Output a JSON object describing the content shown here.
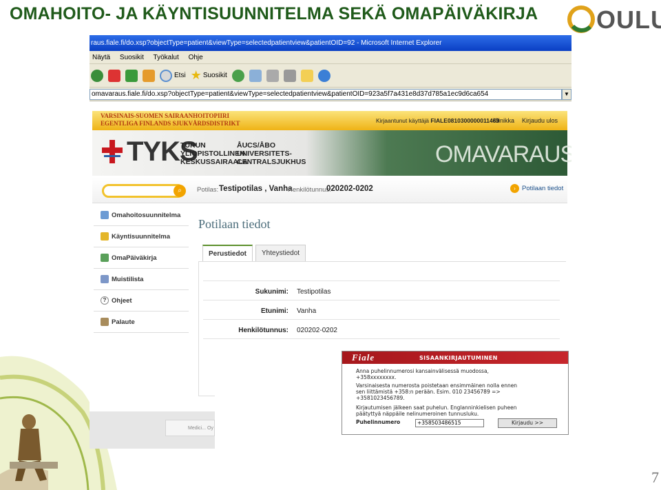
{
  "slide": {
    "title": "OMAHOITO- JA KÄYNTISUUNNITELMA SEKÄ OMAPÄIVÄKIRJA",
    "logo_text": "OULU",
    "page_number": "7"
  },
  "browser": {
    "title": "raus.fiale.fi/do.xsp?objectType=patient&viewType=selectedpatientview&patientOID=92 - Microsoft Internet Explorer",
    "menu": [
      "Näytä",
      "Suosikit",
      "Työkalut",
      "Ohje"
    ],
    "toolbar": {
      "search_label": "Etsi",
      "favorites_label": "Suosikit"
    },
    "address": "omavaraus.fiale.fi/do.xsp?objectType=patient&viewType=selectedpatientview&patientOID=923a5f7a431e8d37d785a1ec9d6ca654"
  },
  "page": {
    "hospital_fi": "Varsinais-Suomen sairaanhoitopiiri",
    "hospital_sv": "Egentliga Finlands sjukvårdsdistrikt",
    "login_prefix": "Kirjaantunut käyttäjä",
    "login_user": "FIALE0810300000011469",
    "link_clinic": "Klinikka",
    "link_logout": "Kirjaudu ulos",
    "tyks": "TYKS",
    "tyks_fi": [
      "TURUN",
      "YLIOPISTOLLINEN",
      "KESKUSSAIRAALA"
    ],
    "tyks_sv": [
      "ÅUCS/ÅBO",
      "UNIVERSITETS-",
      "CENTRALSJUKHUS"
    ],
    "brand": "OMAVARAUS",
    "patient_label": "Potilas:",
    "patient_name": "Testipotilas , Vanha",
    "ssn_label": "Henkilötunnus:",
    "ssn_value": "020202-0202",
    "patient_info_link": "Potilaan tiedot",
    "sidebar": [
      "Omahoitosuunnitelma",
      "Käyntisuunnitelma",
      "OmaPäiväkirja",
      "Muistilista",
      "Ohjeet",
      "Palaute"
    ],
    "content_title": "Potilaan tiedot",
    "tabs": [
      "Perustiedot",
      "Yhteystiedot"
    ],
    "fields": [
      {
        "label": "Sukunimi:",
        "value": "Testipotilas"
      },
      {
        "label": "Etunimi:",
        "value": "Vanha"
      },
      {
        "label": "Henkilötunnus:",
        "value": "020202-0202"
      }
    ],
    "footer_text": "Medici... Oy"
  },
  "fiale": {
    "logo": "Fiale",
    "header": "SISAANKIRJAUTUMINEN",
    "lines": [
      "Anna puhelinnumerosi kansainvälisessä muodossa,",
      "+358xxxxxxxx.",
      "Varsinaisesta numerosta poistetaan ensimmäinen nolla ennen",
      "sen liittämistä +358:n perään. Esim. 010 23456789 =>",
      "+3581023456789.",
      "Kirjautumisen jälkeen saat puhelun. Englanninkielisen puheen",
      "päätyttyä näppäile nelinumeroinen tunnusluku."
    ],
    "phone_label": "Puhelinnumero",
    "phone_value": "+358503486515",
    "login_button": "Kirjaudu >>"
  },
  "colors": {
    "title_green": "#1f5a1a",
    "fiale_red": "#b01e22",
    "accent_orange": "#f2a400"
  }
}
